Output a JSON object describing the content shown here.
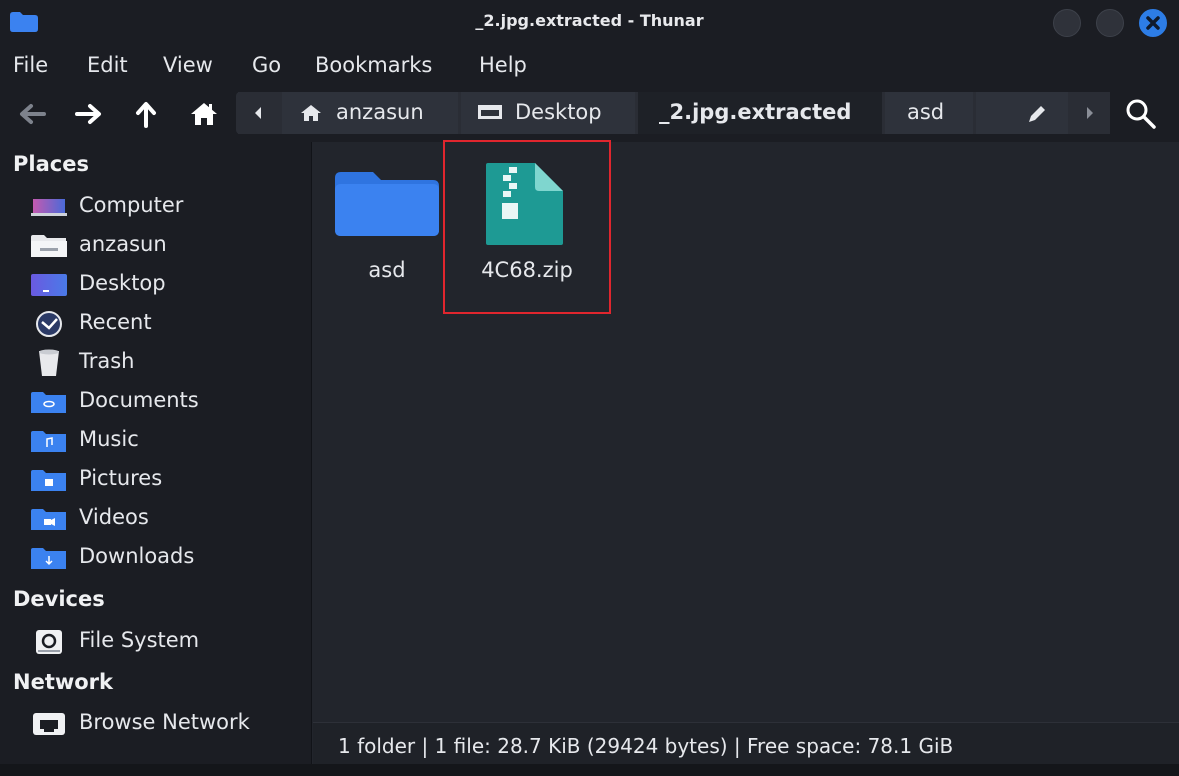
{
  "window": {
    "title": "_2.jpg.extracted - Thunar"
  },
  "menu": [
    "File",
    "Edit",
    "View",
    "Go",
    "Bookmarks",
    "Help"
  ],
  "toolbar": {
    "back_icon": "arrow-left-icon",
    "forward_icon": "arrow-right-icon",
    "up_icon": "arrow-up-icon",
    "home_icon": "home-icon",
    "search_icon": "search-icon"
  },
  "breadcrumb": {
    "items": [
      {
        "label": "anzasun",
        "icon": "home-icon"
      },
      {
        "label": "Desktop",
        "icon": "desktop-icon"
      },
      {
        "label": "_2.jpg.extracted",
        "active": true
      },
      {
        "label": "asd"
      }
    ]
  },
  "sidebar": {
    "places_header": "Places",
    "places": [
      {
        "label": "Computer",
        "icon": "computer-icon"
      },
      {
        "label": "anzasun",
        "icon": "home-folder-icon"
      },
      {
        "label": "Desktop",
        "icon": "desktop-folder-icon"
      },
      {
        "label": "Recent",
        "icon": "recent-icon"
      },
      {
        "label": "Trash",
        "icon": "trash-icon"
      },
      {
        "label": "Documents",
        "icon": "documents-folder-icon"
      },
      {
        "label": "Music",
        "icon": "music-folder-icon"
      },
      {
        "label": "Pictures",
        "icon": "pictures-folder-icon"
      },
      {
        "label": "Videos",
        "icon": "videos-folder-icon"
      },
      {
        "label": "Downloads",
        "icon": "downloads-folder-icon"
      }
    ],
    "devices_header": "Devices",
    "devices": [
      {
        "label": "File System",
        "icon": "drive-icon"
      }
    ],
    "network_header": "Network",
    "network": [
      {
        "label": "Browse Network",
        "icon": "network-icon"
      }
    ]
  },
  "files": [
    {
      "name": "asd",
      "icon": "folder-icon"
    },
    {
      "name": "4C68.zip",
      "icon": "zip-archive-icon"
    }
  ],
  "status": {
    "text": "1 folder  |  1 file: 28.7 KiB (29424 bytes)  |  Free space: 78.1 GiB"
  },
  "colors": {
    "accent": "#2d7de6",
    "folder": "#3b82f0",
    "zip": "#1e9a94",
    "highlight": "#e0262e"
  }
}
